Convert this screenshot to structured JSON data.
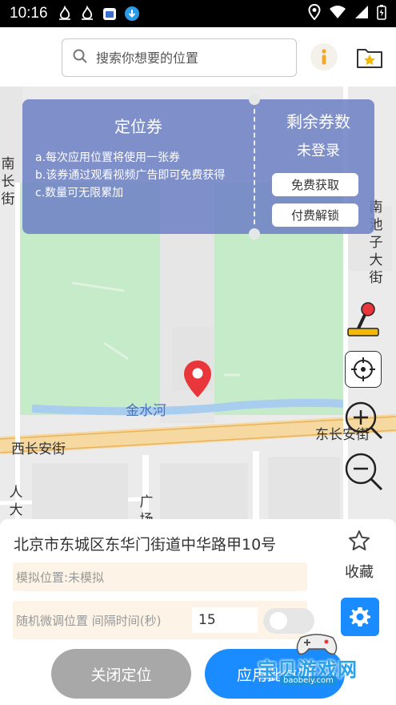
{
  "status_bar": {
    "time": "10:16",
    "icons": [
      "flame-icon",
      "flame-icon",
      "calendar-icon",
      "download-icon"
    ],
    "right_icons": [
      "location-icon",
      "wifi-icon",
      "signal-icon",
      "battery-icon"
    ]
  },
  "search": {
    "placeholder": "搜索你想要的位置"
  },
  "toolbar": {
    "info_label": "i"
  },
  "coupon": {
    "title": "定位券",
    "rules": [
      "a.每次应用位置将使用一张券",
      "b.该券通过观看视频广告即可免费获得",
      "c.数量可无限累加"
    ],
    "count_title": "剩余券数",
    "login_status": "未登录",
    "free_button": "免费获取",
    "paid_button": "付费解锁"
  },
  "map": {
    "labels": {
      "nan_chang_jie": "南长街",
      "nan_chi_zi": "南池子大街",
      "jin_shui_he": "金水河",
      "xi_chang_an": "西长安街",
      "dong_chang_an": "东长安街",
      "ren_da_hui": "人大会",
      "guang_chang": "广场"
    }
  },
  "panel": {
    "address": "北京市东城区东华门街道中华路甲10号",
    "favorite_label": "收藏",
    "simulate_status": "模拟位置:未模拟",
    "random_label": "随机微调位置 间隔时间(秒)",
    "interval_value": "15",
    "close_button": "关闭定位",
    "apply_button": "应用此位置"
  },
  "watermark": {
    "text": "宝贝游戏网",
    "url": "baobeiy.com"
  },
  "colors": {
    "accent": "#1a8cff",
    "coupon_bg": "#6e80c4",
    "pin": "#e8363a",
    "info": "#f5a623"
  }
}
